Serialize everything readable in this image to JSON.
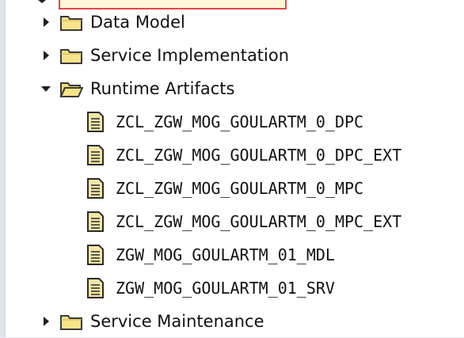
{
  "tree": {
    "items": [
      {
        "label": "Data Model",
        "expanded": false,
        "icon": "folder-icon"
      },
      {
        "label": "Service Implementation",
        "expanded": false,
        "icon": "folder-icon"
      },
      {
        "label": "Runtime Artifacts",
        "expanded": true,
        "icon": "open-folder-icon"
      },
      {
        "label": "ZCL_ZGW_MOG_GOULARTM_0_DPC",
        "icon": "document-icon"
      },
      {
        "label": "ZCL_ZGW_MOG_GOULARTM_0_DPC_EXT",
        "icon": "document-icon"
      },
      {
        "label": "ZCL_ZGW_MOG_GOULARTM_0_MPC",
        "icon": "document-icon"
      },
      {
        "label": "ZCL_ZGW_MOG_GOULARTM_0_MPC_EXT",
        "icon": "document-icon"
      },
      {
        "label": "ZGW_MOG_GOULARTM_01_MDL",
        "icon": "document-icon"
      },
      {
        "label": "ZGW_MOG_GOULARTM_01_SRV",
        "icon": "document-icon"
      },
      {
        "label": "Service Maintenance",
        "expanded": false,
        "icon": "folder-icon"
      }
    ]
  },
  "colors": {
    "folder_fill": "#f8e48a",
    "folder_stroke": "#3a3a3a",
    "document_fill": "#f3e6a9",
    "selection_border": "#e0464f",
    "selection_fill": "#fff7d6"
  }
}
